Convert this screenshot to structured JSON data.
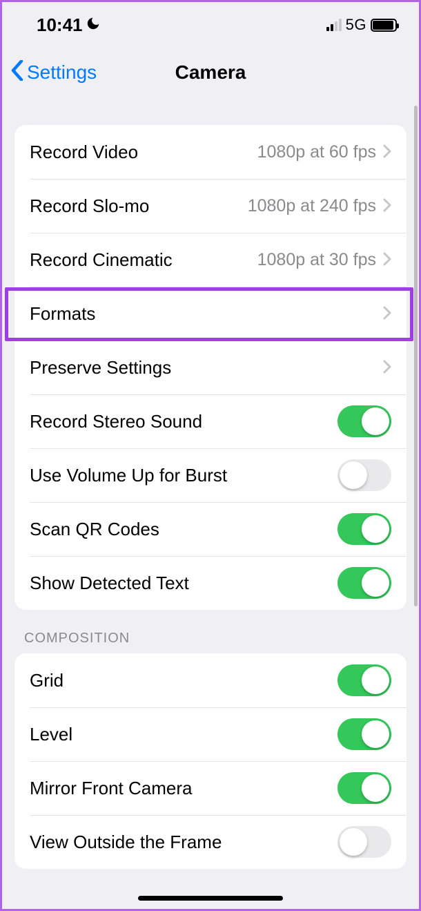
{
  "status": {
    "time": "10:41",
    "network_label": "5G"
  },
  "nav": {
    "back_label": "Settings",
    "title": "Camera"
  },
  "group1": {
    "record_video_label": "Record Video",
    "record_video_value": "1080p at 60 fps",
    "record_slomo_label": "Record Slo-mo",
    "record_slomo_value": "1080p at 240 fps",
    "record_cinematic_label": "Record Cinematic",
    "record_cinematic_value": "1080p at 30 fps",
    "formats_label": "Formats",
    "preserve_label": "Preserve Settings",
    "stereo_label": "Record Stereo Sound",
    "stereo_on": true,
    "volume_burst_label": "Use Volume Up for Burst",
    "volume_burst_on": false,
    "scan_qr_label": "Scan QR Codes",
    "scan_qr_on": true,
    "detected_text_label": "Show Detected Text",
    "detected_text_on": true
  },
  "composition_header": "COMPOSITION",
  "group2": {
    "grid_label": "Grid",
    "grid_on": true,
    "level_label": "Level",
    "level_on": true,
    "mirror_label": "Mirror Front Camera",
    "mirror_on": true,
    "view_outside_label": "View Outside the Frame",
    "view_outside_on": false
  }
}
